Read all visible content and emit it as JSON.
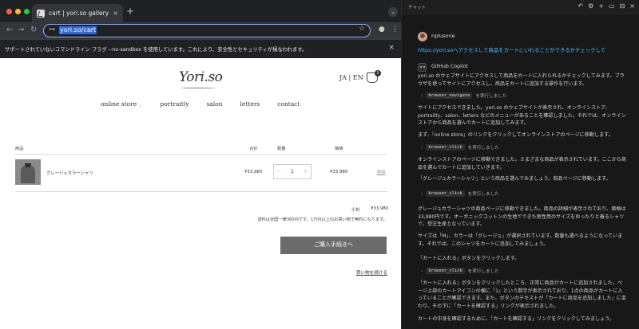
{
  "browser": {
    "tab_title": "cart | yori.so gallery & label",
    "tab_close": "×",
    "new_tab": "+",
    "tab_menu": "⌄",
    "url": "yori.so/cart",
    "infobar_text": "サポートされていないコマンドライン フラグ --no-sandbox を使用しています。これにより、安全性とセキュリティが損なわれます。",
    "infobar_close": "×",
    "traffic_colors": [
      "#ff5f57",
      "#febc2e",
      "#28c840"
    ],
    "icons": {
      "back": "←",
      "forward": "→",
      "reload": "↻",
      "tune": "⊶",
      "star": "☆",
      "profile": "●",
      "menu": "⋮"
    }
  },
  "site": {
    "logo": "Yori.so",
    "lang": "JA | EN",
    "cart_count": "1",
    "nav": [
      {
        "label": "online store",
        "caret": "⌄"
      },
      {
        "label": "portraitly"
      },
      {
        "label": "salon"
      },
      {
        "label": "letters"
      },
      {
        "label": "contact"
      }
    ],
    "table_headers": {
      "product": "商品",
      "total": "合計",
      "quantity": "数量",
      "price": "価格"
    },
    "item": {
      "name": "グレージュカラーシャツ",
      "total": "¥33,980",
      "quantity": "1",
      "minus": "−",
      "plus": "+",
      "price": "¥33,980",
      "remove": "削除"
    },
    "subtotal_label": "小計",
    "subtotal_value": "¥33,980",
    "shipping_note": "送料は全国一律360円です。1万円以上のお買い物で無料になります。",
    "checkout_label": "ご購入手続きへ",
    "continue_label": "買い物を続ける"
  },
  "chat": {
    "header_title": "チャット",
    "header_icons": [
      "↶",
      "⚙",
      "+",
      "▭",
      "⊟",
      "×"
    ],
    "username": "nplusone",
    "user_message": "https://yori.soへアクセスして商品をカートにいれることができるかチェックして",
    "assistant_name": "GitHub Copilot",
    "tool_prefix": "›",
    "tool_suffix": "を実行しました",
    "blocks": [
      {
        "type": "para",
        "text": "yori.so のウェブサイトにアクセスして商品をカートに入れられるかチェックしてみます。ブラウザを使ってサイトにアクセスし、商品をカートに追加する操作を行います。"
      },
      {
        "type": "tool",
        "name": "browser_navigate"
      },
      {
        "type": "para",
        "text": "サイトにアクセスできました。yori.so のウェブサイトが表示され、オンラインストア、portraitly、salon、letters などのメニューがあることを確認しました。それでは、オンラインストアから商品を選んでカートに追加してみます。"
      },
      {
        "type": "para",
        "text": "まず、「online store」のリンクをクリックしてオンラインストアのページに移動します。"
      },
      {
        "type": "tool",
        "name": "browser_click"
      },
      {
        "type": "para",
        "text": "オンラインストアのページに移動できました。さまざまな商品が表示されています。ここから商品を選んでカートに追加していきます。"
      },
      {
        "type": "para",
        "text": "「グレージュカラーシャツ」という商品を選んでみましょう。商品ページに移動します。"
      },
      {
        "type": "tool",
        "name": "browser_click"
      },
      {
        "type": "para",
        "text": "グレージュカラーシャツの商品ページに移動できました。商品の詳細が表示されており、価格は33,980円です。オーガニックコットンの生地でできた男性用のサイズをゆったりと着るシャツで、受注生産となっています。"
      },
      {
        "type": "para",
        "text": "サイズは「M」、カラーは「グレージュ」が選択されています。数量も選べるようになっています。それでは、このシャツをカートに追加してみましょう。"
      },
      {
        "type": "para",
        "text": "「カートに入れる」ボタンをクリックします。"
      },
      {
        "type": "tool",
        "name": "browser_click"
      },
      {
        "type": "para",
        "text": "「カートに入れる」ボタンをクリックしたところ、正常に商品がカートに追加されました。ページ上部のカートアイコンの横に「1」という数字が表示されており、1点の商品がカートに入っていることが確認できます。また、ボタンのテキストが「カートに商品を追加しました」に変わり、その下に「カートを確認する」リンクが表示されました。"
      },
      {
        "type": "para",
        "text": "カートの中身を確認するために、「カートを確認する」リンクをクリックしてみましょう。"
      }
    ]
  }
}
